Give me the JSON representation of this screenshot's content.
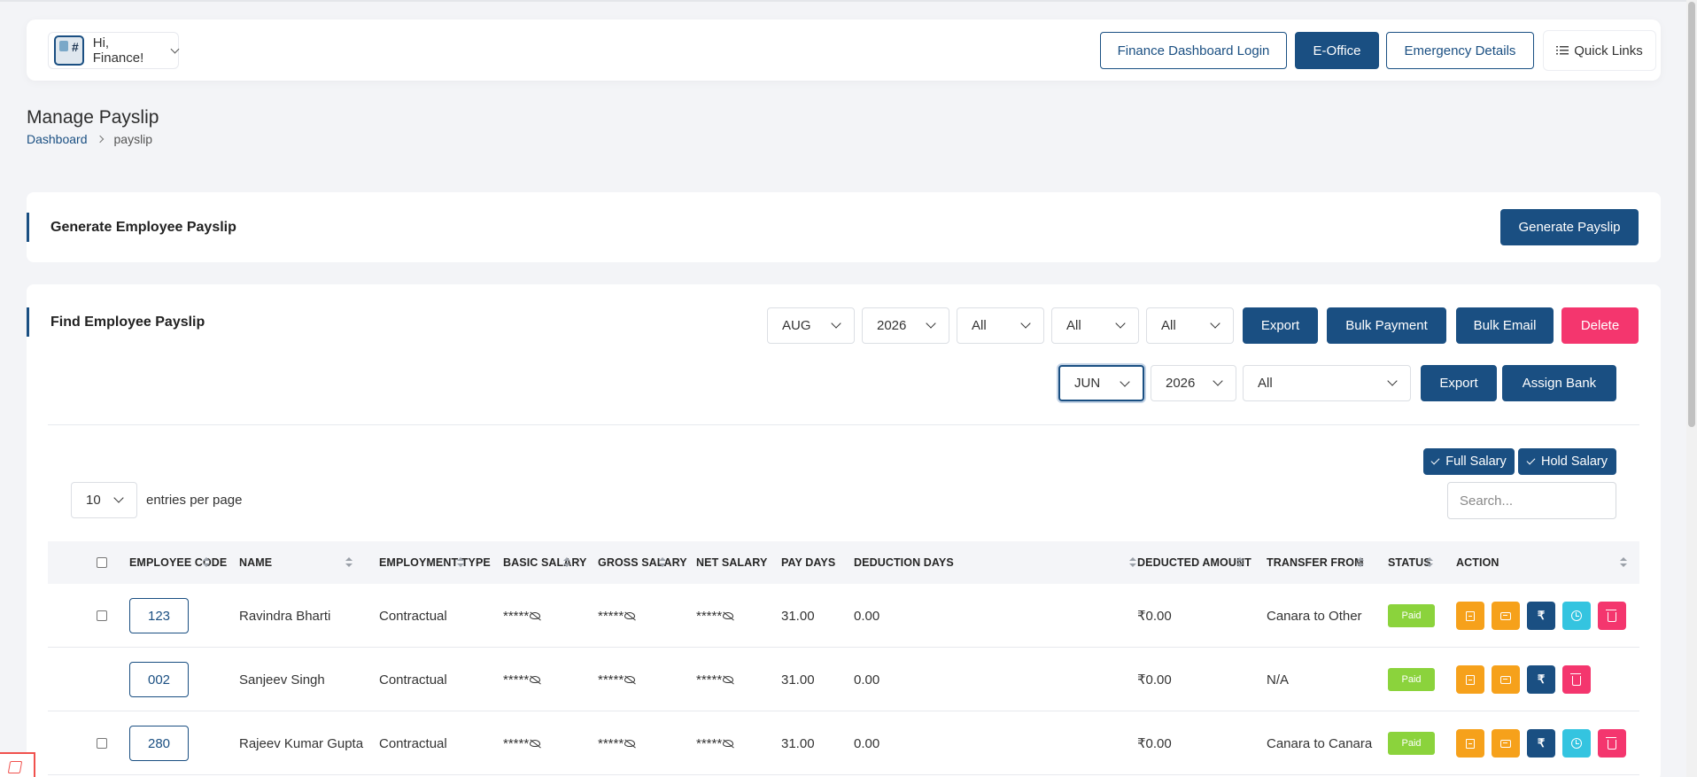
{
  "header": {
    "greeting": "Hi, Finance!",
    "buttons": {
      "finance_dashboard": "Finance Dashboard Login",
      "eoffice": "E-Office",
      "emergency": "Emergency Details",
      "quick_links": "Quick Links"
    }
  },
  "page": {
    "title": "Manage Payslip",
    "breadcrumb": {
      "home": "Dashboard",
      "current": "payslip"
    }
  },
  "generate_card": {
    "title": "Generate Employee Payslip",
    "button": "Generate Payslip"
  },
  "find_card": {
    "title": "Find Employee Payslip",
    "filters_row1": {
      "month": "AUG",
      "year": "2026",
      "filter3": "All",
      "filter4": "All",
      "filter5": "All"
    },
    "row1_buttons": {
      "export": "Export",
      "bulk_payment": "Bulk Payment",
      "bulk_email": "Bulk Email",
      "delete": "Delete"
    },
    "filters_row2": {
      "month": "JUN",
      "year": "2026",
      "filter3": "All"
    },
    "row2_buttons": {
      "export": "Export",
      "assign_bank": "Assign Bank"
    },
    "toggles": {
      "full_salary": "Full Salary",
      "hold_salary": "Hold Salary"
    },
    "entries": {
      "value": "10",
      "label": "entries per page"
    },
    "search_placeholder": "Search..."
  },
  "table": {
    "headers": {
      "code": "EMPLOYEE CODE",
      "name": "NAME",
      "type": "EMPLOYMENT TYPE",
      "basic": "BASIC SALARY",
      "gross": "GROSS SALARY",
      "net": "NET SALARY",
      "pay_days": "PAY DAYS",
      "deduction_days": "DEDUCTION DAYS",
      "deducted_amount": "DEDUCTED AMOUNT",
      "transfer_from": "TRANSFER FROM",
      "status": "STATUS",
      "action": "ACTION"
    },
    "rows": [
      {
        "code": "123",
        "name": "Ravindra Bharti",
        "type": "Contractual",
        "basic": "*****",
        "gross": "*****",
        "net": "*****",
        "pay_days": "31.00",
        "deduction_days": "0.00",
        "deducted_amount": "₹0.00",
        "transfer_from": "Canara to Other",
        "status": "Paid",
        "rupee": "₹"
      },
      {
        "code": "002",
        "name": "Sanjeev Singh",
        "type": "Contractual",
        "basic": "*****",
        "gross": "*****",
        "net": "*****",
        "pay_days": "31.00",
        "deduction_days": "0.00",
        "deducted_amount": "₹0.00",
        "transfer_from": "N/A",
        "status": "Paid",
        "rupee": "₹"
      },
      {
        "code": "280",
        "name": "Rajeev Kumar Gupta",
        "type": "Contractual",
        "basic": "*****",
        "gross": "*****",
        "net": "*****",
        "pay_days": "31.00",
        "deduction_days": "0.00",
        "deducted_amount": "₹0.00",
        "transfer_from": "Canara to Canara",
        "status": "Paid",
        "rupee": "₹"
      }
    ]
  },
  "colors": {
    "primary": "#1a4f82",
    "danger": "#f4366e",
    "warning": "#f6a11b",
    "info": "#34c4e0",
    "success": "#8bd33c"
  }
}
